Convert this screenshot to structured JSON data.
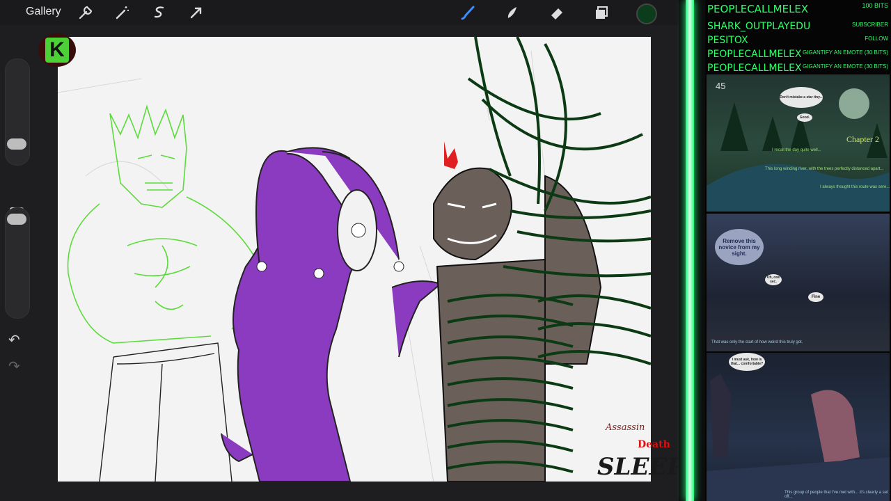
{
  "app": {
    "gallery_label": "Gallery",
    "tools": [
      "wrench-icon",
      "magic-wand-icon",
      "selection-icon",
      "transform-arrow-icon"
    ],
    "brush_tools": [
      "brush-icon",
      "smudge-icon",
      "eraser-icon",
      "layers-icon"
    ],
    "active_color": "#0b3d1c"
  },
  "stream": {
    "events": [
      {
        "name": "PEOPLECALLMELEX",
        "action": "100 BITS"
      },
      {
        "name": "SHARK_OUTPLAYEDU",
        "action": "SUBSCRIBER"
      },
      {
        "name": "PESITOX",
        "action": "FOLLOW"
      },
      {
        "name": "PEOPLECALLMELEX",
        "action": "GIGANTIFY AN EMOTE (30 BITS)"
      },
      {
        "name": "PEOPLECALLMELEX",
        "action": "GIGANTIFY AN EMOTE (30 BITS)"
      }
    ],
    "accent_color": "#2dff6a"
  },
  "comic": {
    "page_number": "45",
    "chapter": "Chapter 2",
    "bubble1": "Don't mistake a star tiny...",
    "bubble1b": "Good.",
    "line1": "I recall the day quite well...",
    "line2": "This long winding river, with the trees perfectly distanced apart...",
    "line3": "I always thought this route was sere...",
    "bubble2": "Remove this novice from my sight.",
    "bubble3": "Uh, one sec.",
    "bubble4": "Fine",
    "line4": "That was only the start of how weird this truly got.",
    "bubble5": "I must ask, how is that... comfortable?",
    "line5": "This group of people that I've met with... it's clearly a set off..."
  },
  "watermark": {
    "line1": "Assassin",
    "line2": "Death",
    "line3": "SLEEP"
  },
  "logo": {
    "letter": "K"
  }
}
